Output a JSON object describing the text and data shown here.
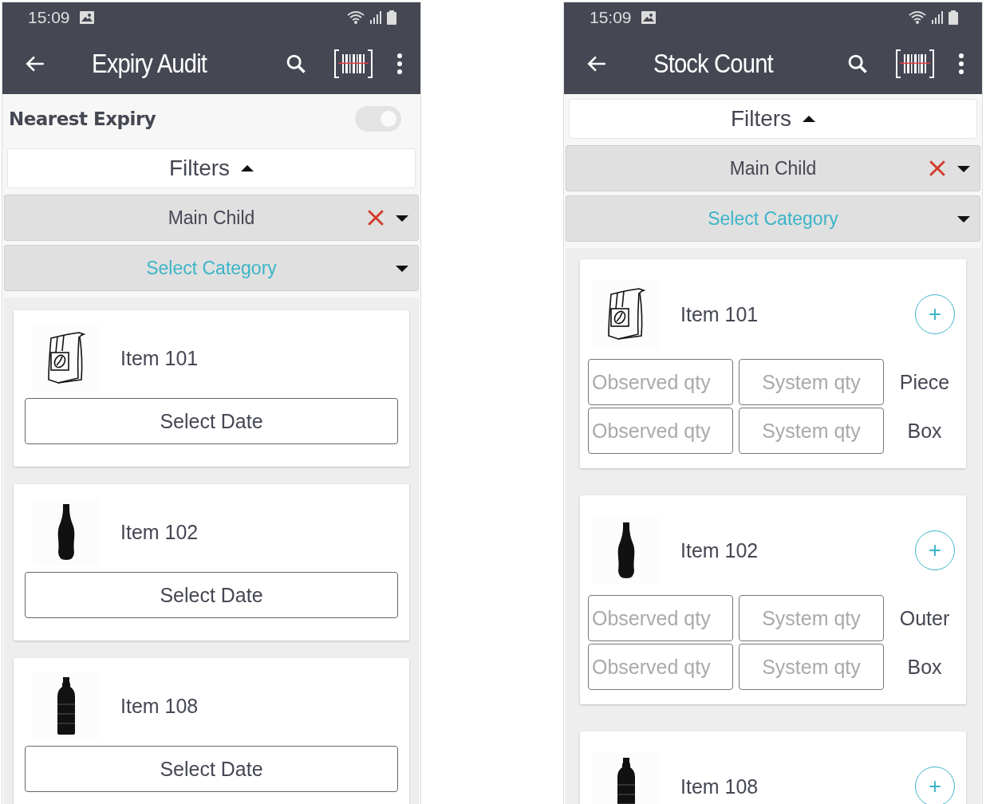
{
  "screens": [
    {
      "status_bar": {
        "time": "15:09"
      },
      "app_bar": {
        "title": "Expiry Audit"
      },
      "nearest_expiry": {
        "label": "Nearest Expiry",
        "on": true
      },
      "filters": {
        "label": "Filters",
        "expanded": true
      },
      "dropdowns": [
        {
          "kind": "value",
          "value": "Main Child",
          "clearable": true
        },
        {
          "kind": "placeholder",
          "placeholder": "Select Category",
          "clearable": false
        }
      ],
      "items": [
        {
          "kind": "date",
          "name": "Item 101",
          "button": "Select Date"
        },
        {
          "kind": "date",
          "name": "Item 102",
          "button": "Select Date"
        },
        {
          "kind": "date",
          "name": "Item 108",
          "button": "Select Date"
        }
      ]
    },
    {
      "status_bar": {
        "time": "15:09"
      },
      "app_bar": {
        "title": "Stock Count"
      },
      "filters": {
        "label": "Filters",
        "expanded": true
      },
      "dropdowns": [
        {
          "kind": "value",
          "value": "Main Child",
          "clearable": true
        },
        {
          "kind": "placeholder",
          "placeholder": "Select Category",
          "clearable": false
        }
      ],
      "items": [
        {
          "kind": "count",
          "name": "Item 101",
          "add_button": "+",
          "units": [
            {
              "unit": "Piece",
              "observed_placeholder": "Observed qty",
              "system_placeholder": "System qty"
            },
            {
              "unit": "Box",
              "observed_placeholder": "Observed qty",
              "system_placeholder": "System qty"
            }
          ]
        },
        {
          "kind": "count",
          "name": "Item 102",
          "add_button": "+",
          "units": [
            {
              "unit": "Outer",
              "observed_placeholder": "Observed qty",
              "system_placeholder": "System qty"
            },
            {
              "unit": "Box",
              "observed_placeholder": "Observed qty",
              "system_placeholder": "System qty"
            }
          ]
        },
        {
          "kind": "count",
          "name": "Item 108",
          "add_button": "+"
        }
      ]
    }
  ]
}
